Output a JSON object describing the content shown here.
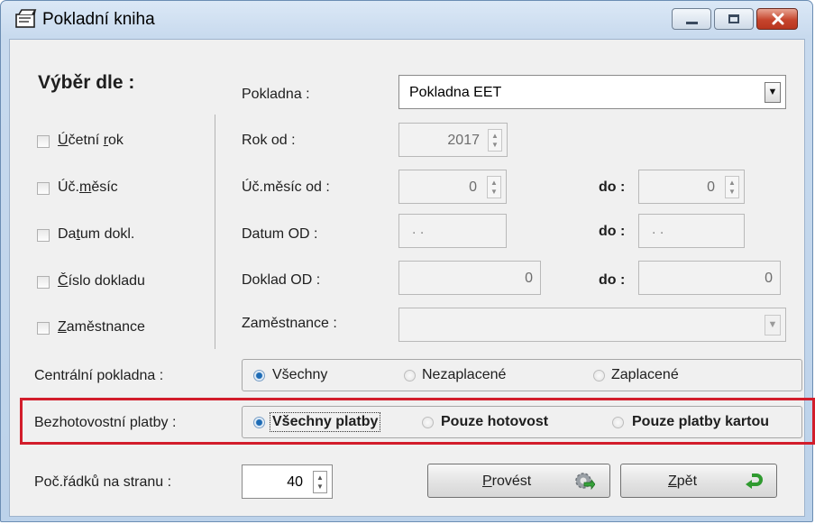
{
  "window": {
    "title": "Pokladní kniha",
    "minimize": "—",
    "maximize": "▭",
    "close": "✕"
  },
  "filter": {
    "heading": "Výběr dle :",
    "checkboxes": [
      {
        "pre": "",
        "u": "Ú",
        "post": "četní ",
        "u2": "r",
        "post2": "ok"
      },
      {
        "pre": "Úč.",
        "u": "m",
        "post": "ěsíc",
        "u2": "",
        "post2": ""
      },
      {
        "pre": "Da",
        "u": "t",
        "post": "um dokl.",
        "u2": "",
        "post2": ""
      },
      {
        "pre": "",
        "u": "Č",
        "post": "íslo dokladu",
        "u2": "",
        "post2": ""
      },
      {
        "pre": "",
        "u": "Z",
        "post": "aměstnance",
        "u2": "",
        "post2": ""
      }
    ]
  },
  "fields": {
    "pokladna_label": "Pokladna :",
    "pokladna_value": "Pokladna EET",
    "rok_label": "Rok od :",
    "rok_value": "2017",
    "mesic_label": "Úč.měsíc od :",
    "mesic_from": "0",
    "mesic_to_label": "do :",
    "mesic_to": "0",
    "datum_label": "Datum OD :",
    "datum_from": ". .",
    "datum_to_label": "do :",
    "datum_to": ". .",
    "doklad_label": "Doklad OD :",
    "doklad_from": "0",
    "doklad_to_label": "do :",
    "doklad_to": "0",
    "zam_label": "Zaměstnance :",
    "zam_value": ""
  },
  "central": {
    "label": "Centrální pokladna :",
    "options": [
      "Všechny",
      "Nezaplacené",
      "Zaplacené"
    ],
    "selected": "Všechny"
  },
  "cashless": {
    "label": "Bezhotovostní platby :",
    "options": [
      "Všechny platby",
      "Pouze hotovost",
      "Pouze platby kartou"
    ],
    "selected": "Všechny platby"
  },
  "rows": {
    "label": "Poč.řádků na stranu :",
    "value": "40"
  },
  "buttons": {
    "execute_u": "P",
    "execute_rest": "rovést",
    "back_u": "Z",
    "back_rest": "pět"
  },
  "icons": {
    "title": "cash-book-icon",
    "execute": "gear-arrow-icon",
    "back": "green-return-arrow-icon"
  }
}
